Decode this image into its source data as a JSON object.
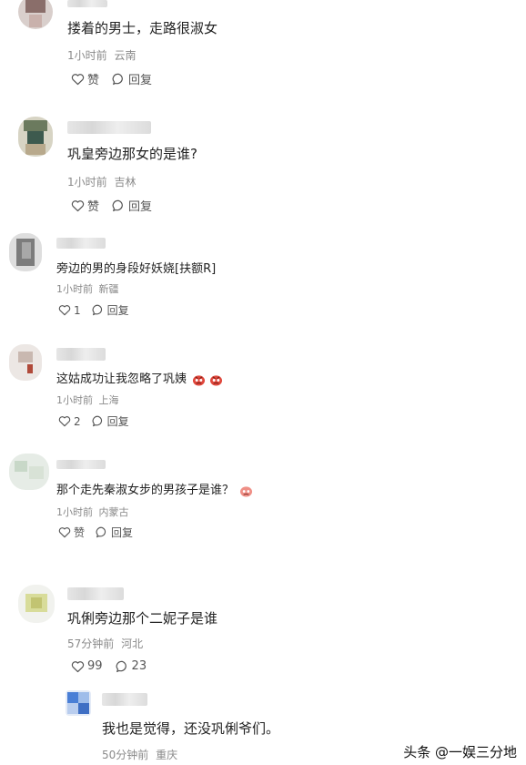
{
  "comments": [
    {
      "text": "搂着的男士，走路很淑女",
      "time": "1小时前",
      "location": "云南",
      "like_label": "赞",
      "reply_label": "回复"
    },
    {
      "text": "巩皇旁边那女的是谁?",
      "time": "1小时前",
      "location": "吉林",
      "like_label": "赞",
      "reply_label": "回复"
    },
    {
      "text": "旁边的男的身段好妖娆[扶额R]",
      "time": "1小时前",
      "location": "新疆",
      "like_label": "1",
      "reply_label": "回复"
    },
    {
      "text": "这姑成功让我忽略了巩姨",
      "time": "1小时前",
      "location": "上海",
      "like_label": "2",
      "reply_label": "回复"
    },
    {
      "text": "那个走先秦淑女步的男孩子是谁？",
      "time": "1小时前",
      "location": "内蒙古",
      "like_label": "赞",
      "reply_label": "回复"
    },
    {
      "text": "巩俐旁边那个二妮子是谁",
      "time": "57分钟前",
      "location": "河北",
      "like_label": "99",
      "reply_label": "23"
    },
    {
      "text": "我也是觉得，还没巩俐爷们。",
      "time": "50分钟前",
      "location": "重庆"
    }
  ],
  "watermark": "头条 @一娱三分地",
  "icons": {
    "like": "heart-outline-icon",
    "reply": "speech-bubble-icon",
    "emoji": "angry-face-emoji"
  }
}
